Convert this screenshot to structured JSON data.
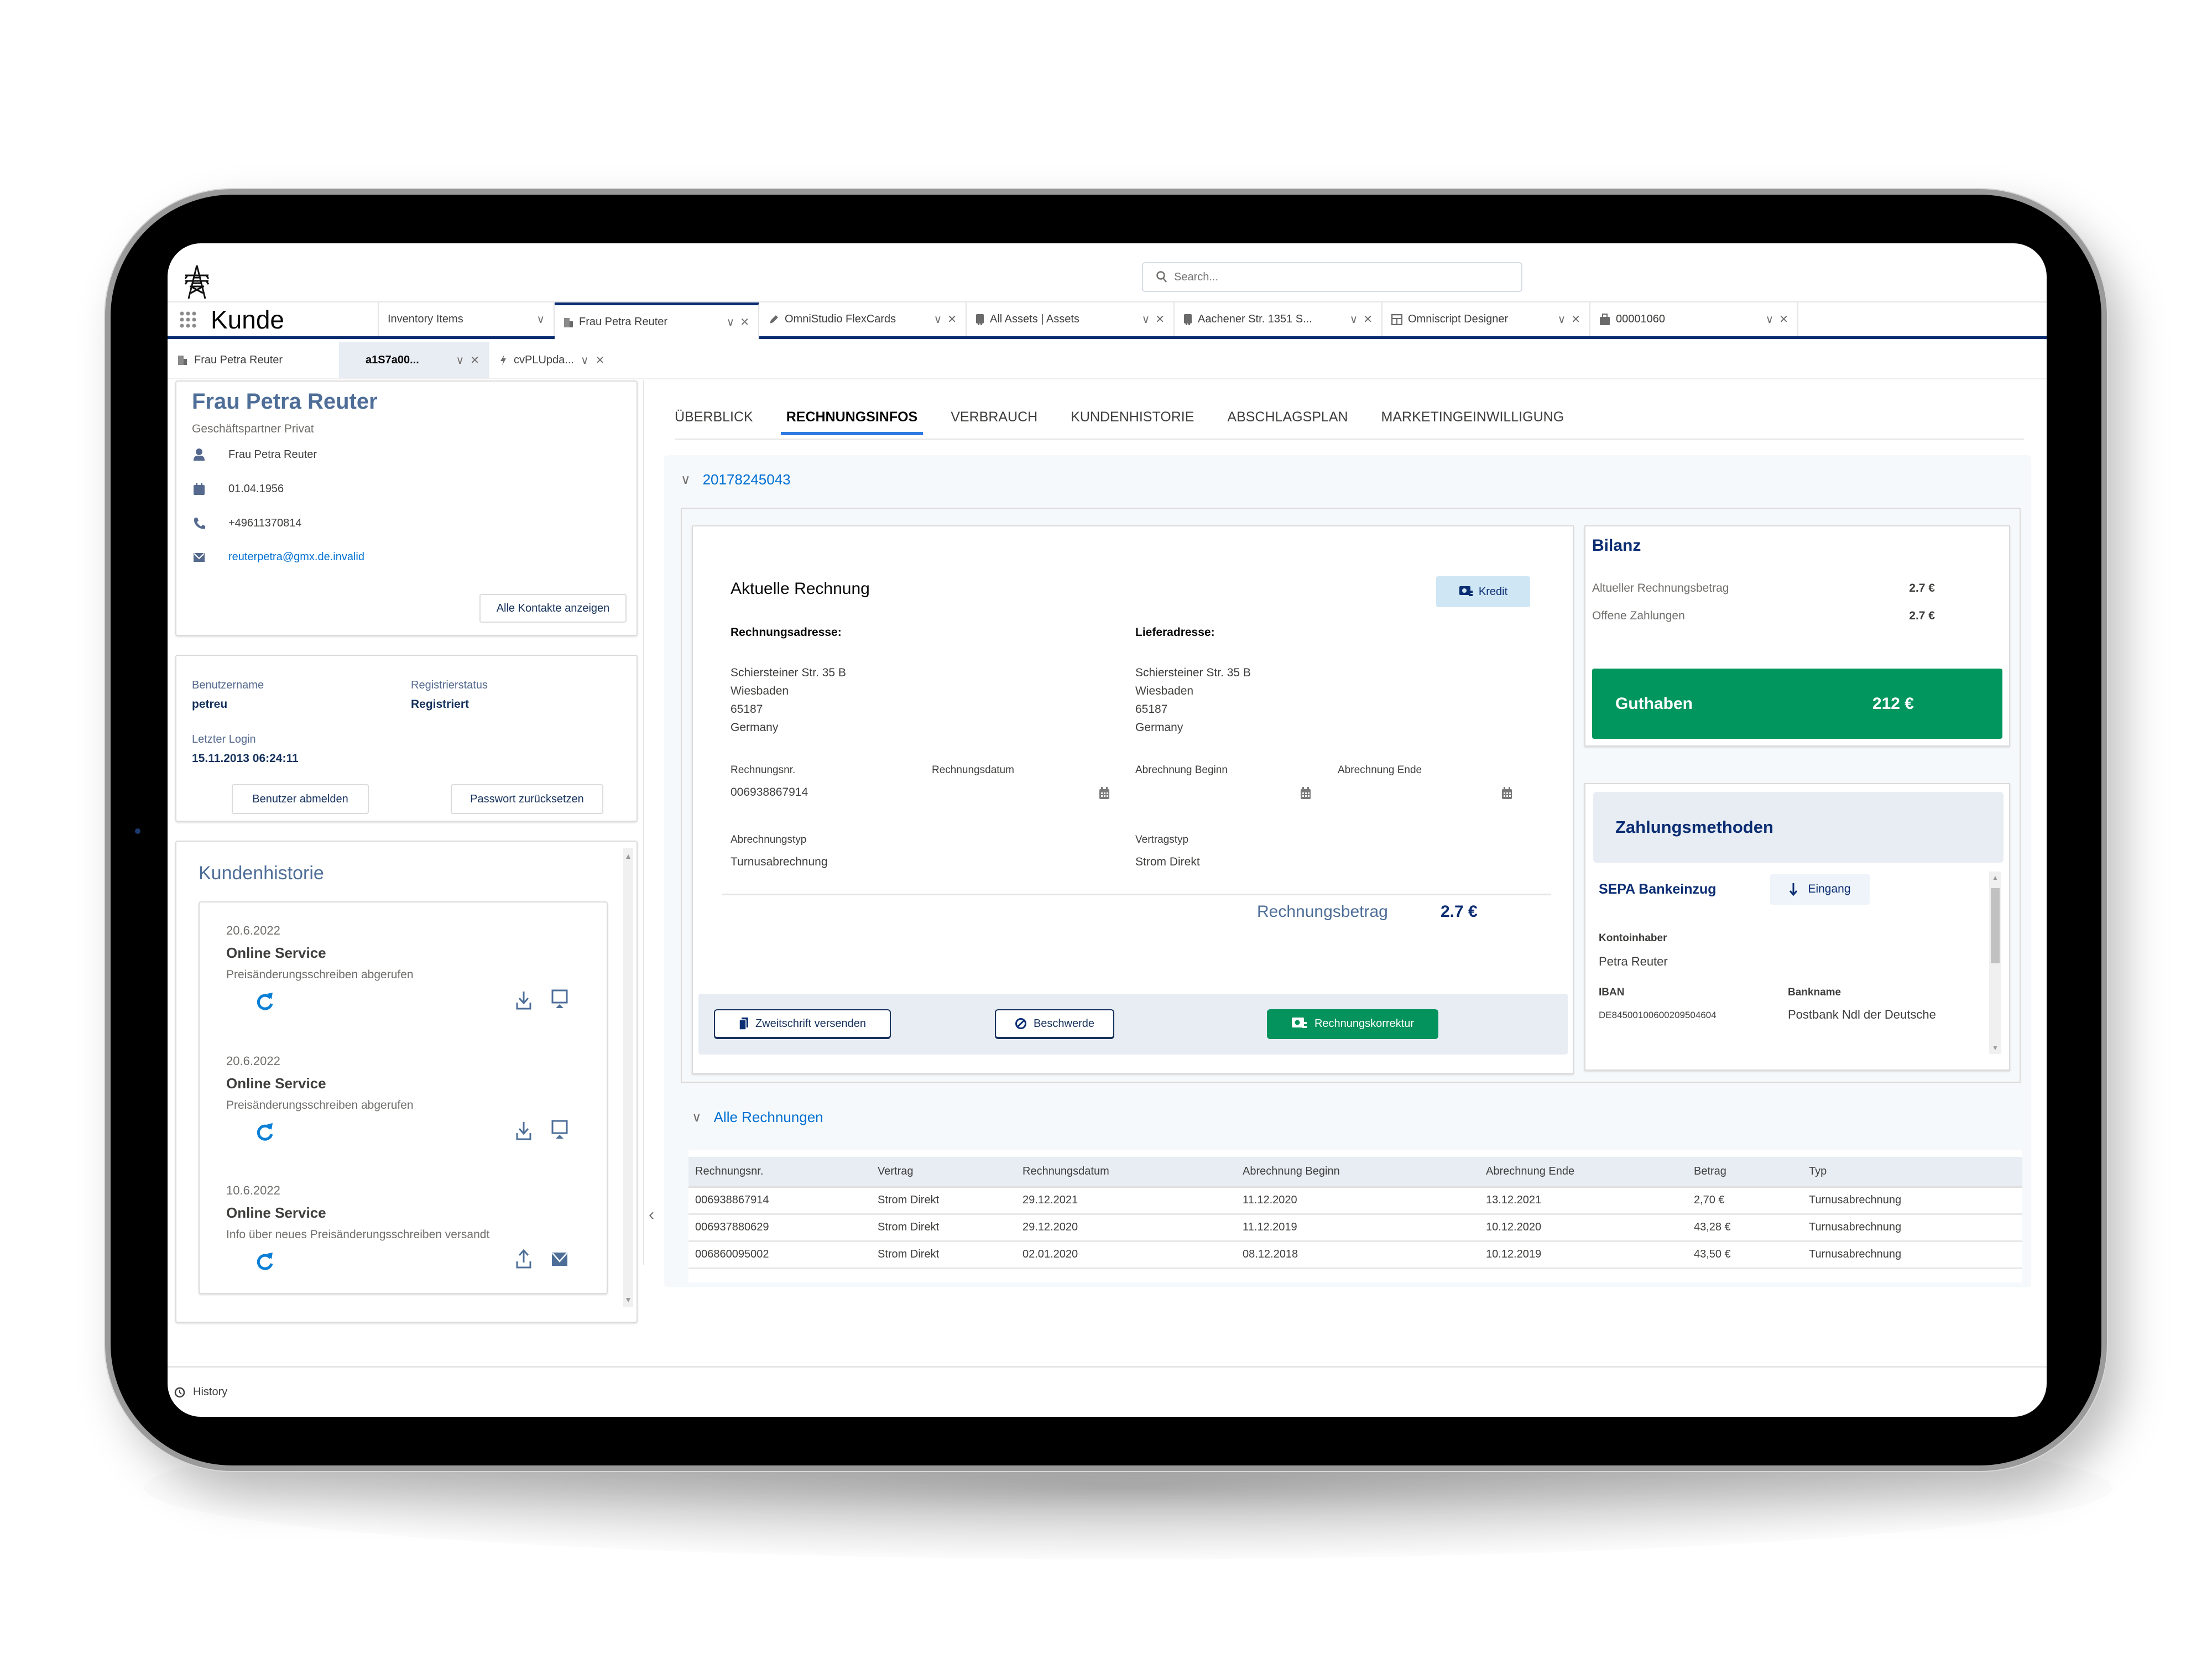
{
  "app": {
    "name": "Kunde",
    "logo_icon": "power-tower-icon",
    "search_placeholder": "Search...",
    "colors": {
      "nav_accent": "#0b2d72",
      "link": "#0070d2",
      "success": "#00965e",
      "tab_underline": "#2c7ae0"
    }
  },
  "top_tabs": [
    {
      "label": "Inventory Items",
      "icon": "",
      "active": false
    },
    {
      "label": "Frau Petra Reuter",
      "icon": "building-icon",
      "active": true
    },
    {
      "label": "OmniStudio FlexCards",
      "icon": "pencil-icon",
      "active": false
    },
    {
      "label": "All Assets | Assets",
      "icon": "asset-icon",
      "active": false
    },
    {
      "label": "Aachener Str. 1351 S...",
      "icon": "asset-icon",
      "active": false
    },
    {
      "label": "Omniscript Designer",
      "icon": "layout-icon",
      "active": false
    },
    {
      "label": "00001060",
      "icon": "case-icon",
      "active": false
    }
  ],
  "sub_tabs": [
    {
      "label": "Frau Petra Reuter",
      "icon": "building-icon",
      "active": false
    },
    {
      "label": "a1S7a00...",
      "icon": "",
      "active": true
    },
    {
      "label": "cvPLUpda...",
      "icon": "bolt-icon",
      "active": false
    }
  ],
  "contact": {
    "name": "Frau Petra Reuter",
    "type": "Geschäftspartner Privat",
    "person": "Frau Petra Reuter",
    "birthdate": "01.04.1956",
    "phone": "+49611370814",
    "email": "reuterpetra@gmx.de.invalid",
    "all_contacts_button": "Alle Kontakte anzeigen"
  },
  "account": {
    "username_label": "Benutzername",
    "username": "petreu",
    "status_label": "Registrierstatus",
    "status": "Registriert",
    "last_login_label": "Letzter Login",
    "last_login": "15.11.2013 06:24:11",
    "logout_button": "Benutzer abmelden",
    "reset_button": "Passwort zurücksetzen"
  },
  "history": {
    "title": "Kundenhistorie",
    "items": [
      {
        "date": "20.6.2022",
        "type": "Online Service",
        "desc": "Preisänderungsschreiben abgerufen",
        "direction": "download",
        "channel": "desktop"
      },
      {
        "date": "20.6.2022",
        "type": "Online Service",
        "desc": "Preisänderungsschreiben abgerufen",
        "direction": "download",
        "channel": "desktop"
      },
      {
        "date": "10.6.2022",
        "type": "Online Service",
        "desc": "Info über neues Preisänderungsschreiben versandt",
        "direction": "upload",
        "channel": "email"
      }
    ]
  },
  "main_tabs": [
    {
      "label": "ÜBERBLICK",
      "active": false
    },
    {
      "label": "RECHNUNGSINFOS",
      "active": true
    },
    {
      "label": "VERBRAUCH",
      "active": false
    },
    {
      "label": "KUNDENHISTORIE",
      "active": false
    },
    {
      "label": "ABSCHLAGSPLAN",
      "active": false
    },
    {
      "label": "MARKETINGEINWILLIGUNG",
      "active": false
    }
  ],
  "contract": {
    "number": "20178245043"
  },
  "invoice": {
    "title": "Aktuelle Rechnung",
    "kredit_button": "Kredit",
    "billing_address_label": "Rechnungsadresse:",
    "billing_address": [
      "Schiersteiner Str. 35 B",
      "Wiesbaden",
      "65187",
      "Germany"
    ],
    "delivery_address_label": "Lieferadresse:",
    "delivery_address": [
      "Schiersteiner Str. 35 B",
      "Wiesbaden",
      "65187",
      "Germany"
    ],
    "number_label": "Rechnungsnr.",
    "number": "006938867914",
    "date_label": "Rechnungsdatum",
    "date": "",
    "period_start_label": "Abrechnung Beginn",
    "period_start": "",
    "period_end_label": "Abrechnung Ende",
    "period_end": "",
    "billing_type_label": "Abrechnungstyp",
    "billing_type": "Turnusabrechnung",
    "contract_type_label": "Vertragstyp",
    "contract_type": "Strom Direkt",
    "amount_label": "Rechnungsbetrag",
    "amount": "2.7 €",
    "actions": {
      "duplicate": "Zweitschrift versenden",
      "complaint": "Beschwerde",
      "correction": "Rechnungskorrektur"
    }
  },
  "balance": {
    "title": "Bilanz",
    "current_label": "Altueller Rechnungsbetrag",
    "current": "2.7 €",
    "open_label": "Offene Zahlungen",
    "open": "2.7 €",
    "credit_label": "Guthaben",
    "credit": "212 €"
  },
  "payment": {
    "title": "Zahlungsmethoden",
    "method": "SEPA Bankeinzug",
    "direction_button": "Eingang",
    "holder_label": "Kontoinhaber",
    "holder": "Petra Reuter",
    "iban_label": "IBAN",
    "iban": "DE84500100600209504604",
    "bank_label": "Bankname",
    "bank": "Postbank Ndl der Deutsche"
  },
  "invoices": {
    "title": "Alle Rechnungen",
    "columns": [
      "Rechnungsnr.",
      "Vertrag",
      "Rechnungsdatum",
      "Abrechnung Beginn",
      "Abrechnung Ende",
      "Betrag",
      "Typ"
    ],
    "rows": [
      [
        "006938867914",
        "Strom Direkt",
        "29.12.2021",
        "11.12.2020",
        "13.12.2021",
        "2,70 €",
        "Turnusabrechnung"
      ],
      [
        "006937880629",
        "Strom Direkt",
        "29.12.2020",
        "11.12.2019",
        "10.12.2020",
        "43,28 €",
        "Turnusabrechnung"
      ],
      [
        "006860095002",
        "Strom Direkt",
        "02.01.2020",
        "08.12.2018",
        "10.12.2019",
        "43,50 €",
        "Turnusabrechnung"
      ]
    ]
  },
  "footer": {
    "history_label": "History"
  }
}
